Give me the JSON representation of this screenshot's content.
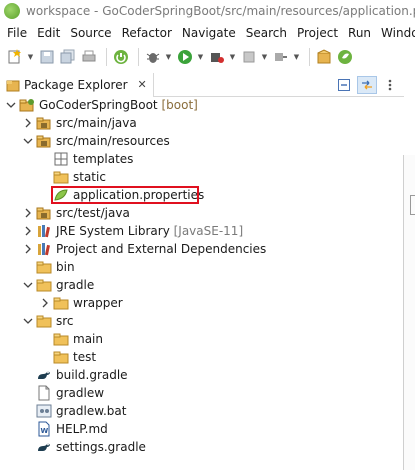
{
  "window": {
    "title": "workspace - GoCoderSpringBoot/src/main/resources/application.properties - Eclipse IDE"
  },
  "menu": [
    "File",
    "Edit",
    "Source",
    "Refactor",
    "Navigate",
    "Search",
    "Project",
    "Run",
    "Window"
  ],
  "view": {
    "tab_label": "Package Explorer",
    "close_glyph": "✕"
  },
  "tree": [
    {
      "label": "GoCoderSpringBoot",
      "decoration": " [boot]",
      "depth": 0,
      "expanded": true,
      "icon": "project-icon"
    },
    {
      "label": "src/main/java",
      "depth": 1,
      "expanded": false,
      "icon": "source-folder-icon"
    },
    {
      "label": "src/main/resources",
      "depth": 1,
      "expanded": true,
      "icon": "source-folder-icon"
    },
    {
      "label": "templates",
      "depth": 2,
      "icon": "package-icon"
    },
    {
      "label": "static",
      "depth": 2,
      "icon": "folder-icon"
    },
    {
      "label": "application.properties",
      "depth": 2,
      "icon": "properties-file-icon",
      "highlighted": true
    },
    {
      "label": "src/test/java",
      "depth": 1,
      "expanded": false,
      "icon": "source-folder-icon"
    },
    {
      "label": "JRE System Library",
      "decoration": " [JavaSE-11]",
      "depth": 1,
      "expanded": false,
      "icon": "library-icon"
    },
    {
      "label": "Project and External Dependencies",
      "depth": 1,
      "expanded": false,
      "icon": "library-icon"
    },
    {
      "label": "bin",
      "depth": 1,
      "icon": "folder-icon"
    },
    {
      "label": "gradle",
      "depth": 1,
      "expanded": true,
      "icon": "folder-icon"
    },
    {
      "label": "wrapper",
      "depth": 2,
      "expanded": false,
      "icon": "folder-icon"
    },
    {
      "label": "src",
      "depth": 1,
      "expanded": true,
      "icon": "folder-icon"
    },
    {
      "label": "main",
      "depth": 2,
      "icon": "folder-icon"
    },
    {
      "label": "test",
      "depth": 2,
      "icon": "folder-icon"
    },
    {
      "label": "build.gradle",
      "depth": 1,
      "icon": "gradle-file-icon"
    },
    {
      "label": "gradlew",
      "depth": 1,
      "icon": "file-icon"
    },
    {
      "label": "gradlew.bat",
      "depth": 1,
      "icon": "bat-file-icon"
    },
    {
      "label": "HELP.md",
      "depth": 1,
      "icon": "markdown-file-icon"
    },
    {
      "label": "settings.gradle",
      "depth": 1,
      "icon": "gradle-file-icon"
    }
  ],
  "colors": {
    "highlight_border": "#e0101f",
    "decoration": "#8a6d3b",
    "folder": "#e8b34a",
    "package": "#6b6b6b"
  }
}
